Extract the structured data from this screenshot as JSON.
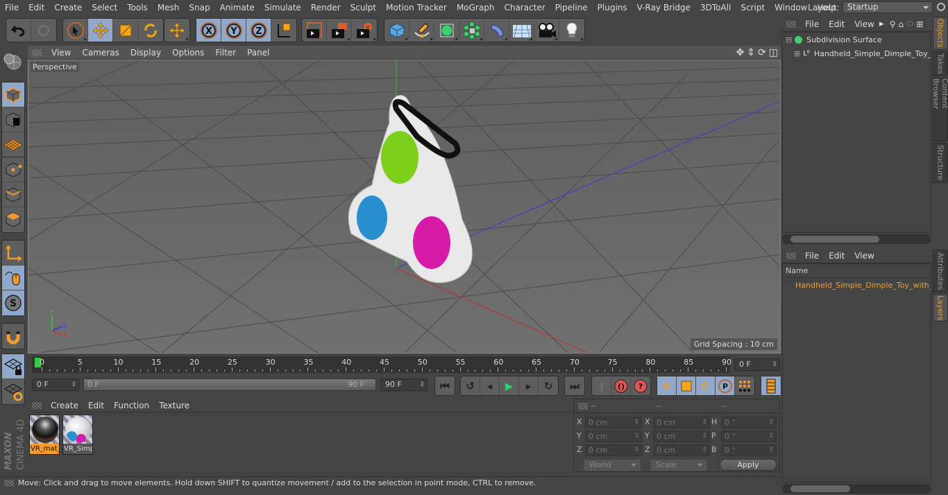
{
  "menubar": {
    "items": [
      "File",
      "Edit",
      "Create",
      "Select",
      "Tools",
      "Mesh",
      "Snap",
      "Animate",
      "Simulate",
      "Render",
      "Sculpt",
      "Motion Tracker",
      "MoGraph",
      "Character",
      "Pipeline",
      "Plugins",
      "V-Ray Bridge",
      "3DToAll",
      "Script",
      "Window",
      "Help"
    ],
    "layout_label": "Layout:",
    "layout_value": "Startup"
  },
  "toolbar": {
    "groups": [
      [
        "undo-icon",
        "redo-icon"
      ],
      [
        "live-selection-icon",
        "move-icon",
        "scale-icon",
        "rotate-icon"
      ],
      [
        "last-tool-icon"
      ],
      [
        "x-axis-icon",
        "y-axis-icon",
        "z-axis-icon",
        "coordinate-system-icon"
      ],
      [
        "render-view-icon",
        "render-picture-viewer-icon",
        "render-settings-icon"
      ],
      [
        "cube-icon",
        "pen-spline-icon",
        "subdivision-icon",
        "array-icon",
        "deformer-icon",
        "floor-icon",
        "camera-icon",
        "light-icon"
      ]
    ],
    "axis_labels": [
      "X",
      "Y",
      "Z"
    ]
  },
  "left_toolbar": {
    "items": [
      "make-editable-icon",
      "model-mode-icon",
      "texture-mode-icon",
      "workplane-icon",
      "points-mode-icon",
      "edges-mode-icon",
      "polygons-mode-icon",
      "axis-mode-icon",
      "tweak-mode-icon",
      "solo-icon",
      "snap-magnet-icon",
      "lock-workplane-icon",
      "workplane-snap-icon"
    ],
    "solo_label": "S"
  },
  "viewport": {
    "menu": [
      "View",
      "Cameras",
      "Display",
      "Options",
      "Filter",
      "Panel"
    ],
    "camera_label": "Perspective",
    "grid_spacing": "Grid Spacing : 10 cm",
    "axis_labels": {
      "x": "X",
      "y": "Y",
      "z": "Z"
    },
    "colors": {
      "green_dimple": "#7ccf1a",
      "blue_dimple": "#2a8fcf",
      "pink_dimple": "#d81aa8",
      "body": "#e8e8e8",
      "ring": "#111111"
    }
  },
  "timeline": {
    "ticks": [
      "0",
      "5",
      "10",
      "15",
      "20",
      "25",
      "30",
      "35",
      "40",
      "45",
      "50",
      "55",
      "60",
      "65",
      "70",
      "75",
      "80",
      "85",
      "90"
    ],
    "current_frame": "0 F",
    "start_frame": "0 F",
    "range_start": "0 F",
    "range_end": "90 F",
    "end_frame": "90 F"
  },
  "transport": {
    "buttons": [
      "go-to-start-icon",
      "previous-key-icon",
      "previous-frame-icon",
      "play-icon",
      "next-frame-icon",
      "next-key-icon",
      "go-to-end-icon",
      "record-keys-icon",
      "autokey-icon",
      "keyframe-selection-icon",
      "key-position-icon",
      "key-scale-icon",
      "key-rotation-icon",
      "key-param-icon",
      "key-pla-icon",
      "timeline-icon"
    ]
  },
  "materials": {
    "menu": [
      "Create",
      "Edit",
      "Function",
      "Texture"
    ],
    "items": [
      {
        "label": "VR_mat_",
        "selected": true
      },
      {
        "label": "VR_Simp",
        "selected": false
      }
    ]
  },
  "coordinates": {
    "headers": [
      "--",
      "--",
      "--"
    ],
    "position": [
      {
        "axis": "X",
        "value": "0 cm"
      },
      {
        "axis": "Y",
        "value": "0 cm"
      },
      {
        "axis": "Z",
        "value": "0 cm"
      }
    ],
    "size": [
      {
        "axis": "X",
        "value": "0 cm"
      },
      {
        "axis": "Y",
        "value": "0 cm"
      },
      {
        "axis": "Z",
        "value": "0 cm"
      }
    ],
    "rotation": [
      {
        "axis": "H",
        "value": "0 °"
      },
      {
        "axis": "P",
        "value": "0 °"
      },
      {
        "axis": "B",
        "value": "0 °"
      }
    ],
    "mode_select": "World",
    "size_select": "Scale",
    "apply_label": "Apply"
  },
  "status_text": "Move: Click and drag to move elements. Hold down SHIFT to quantize movement / add to the selection in point mode, CTRL to remove.",
  "brand": {
    "maxon": "MAXON",
    "product": "CINEMA 4D"
  },
  "objects_panel": {
    "menu": [
      "File",
      "Edit",
      "View"
    ],
    "items": [
      {
        "name": "Subdivision Surface",
        "level": 0
      },
      {
        "name": "Handheld_Simple_Dimple_Toy_with_Carabiner",
        "level": 1
      }
    ]
  },
  "layers_panel": {
    "menu": [
      "File",
      "Edit",
      "View"
    ],
    "column_header": "Name",
    "items": [
      {
        "name": "Handheld_Simple_Dimple_Toy_with_Carabiner",
        "color": "#d0662a"
      }
    ]
  },
  "side_tabs": {
    "top": [
      {
        "label": "Objects",
        "active": true
      },
      {
        "label": "Takes",
        "active": false
      },
      {
        "label": "Content Browser",
        "active": false
      },
      {
        "label": "Structure",
        "active": false
      }
    ],
    "bottom": [
      {
        "label": "Attributes",
        "active": false
      },
      {
        "label": "Layers",
        "active": true
      }
    ]
  }
}
